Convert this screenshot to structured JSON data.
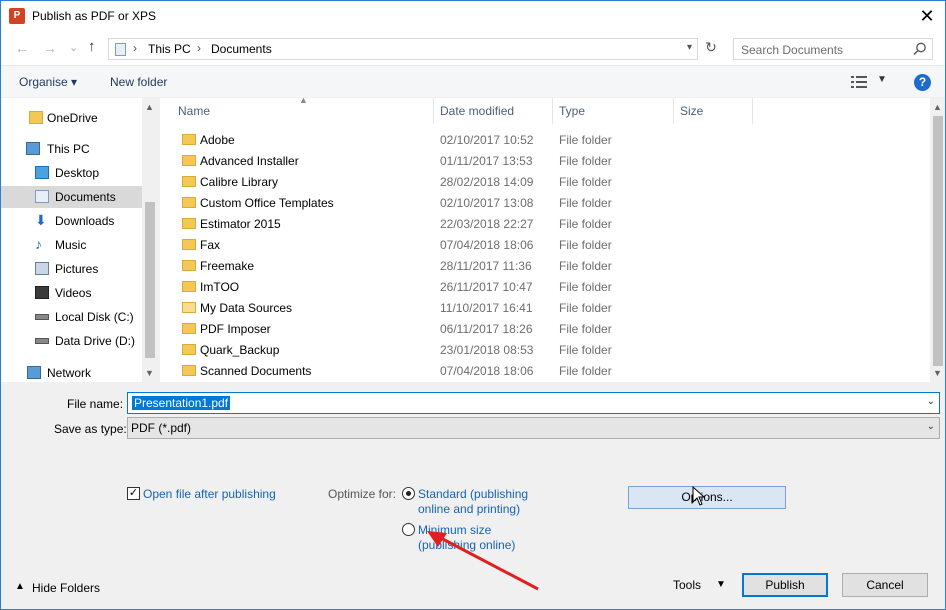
{
  "window": {
    "title": "Publish as PDF or XPS",
    "app_icon": "P",
    "close_glyph": "✕"
  },
  "nav": {
    "back_glyph": "←",
    "forward_glyph": "→",
    "recent_glyph": "⌄",
    "up_glyph": "↑",
    "breadcrumbs": [
      "This PC",
      "Documents"
    ],
    "search_placeholder": "Search Documents"
  },
  "toolbar": {
    "organise": "Organise ▾",
    "new_folder": "New folder",
    "help": "?"
  },
  "sidebar": {
    "items": [
      {
        "label": "OneDrive",
        "icon": "folder-icon"
      },
      {
        "label": "This PC",
        "icon": "computer-icon"
      },
      {
        "label": "Desktop",
        "icon": "desktop-icon"
      },
      {
        "label": "Documents",
        "icon": "documents-icon",
        "selected": true
      },
      {
        "label": "Downloads",
        "icon": "download-icon"
      },
      {
        "label": "Music",
        "icon": "music-icon"
      },
      {
        "label": "Pictures",
        "icon": "pictures-icon"
      },
      {
        "label": "Videos",
        "icon": "videos-icon"
      },
      {
        "label": "Local Disk (C:)",
        "icon": "disk-icon"
      },
      {
        "label": "Data Drive (D:)",
        "icon": "disk-icon"
      },
      {
        "label": "Network",
        "icon": "network-icon"
      }
    ]
  },
  "files": {
    "columns": [
      "Name",
      "Date modified",
      "Type",
      "Size"
    ],
    "rows": [
      {
        "name": "Adobe",
        "date": "02/10/2017 10:52",
        "type": "File folder"
      },
      {
        "name": "Advanced Installer",
        "date": "01/11/2017 13:53",
        "type": "File folder"
      },
      {
        "name": "Calibre Library",
        "date": "28/02/2018 14:09",
        "type": "File folder"
      },
      {
        "name": "Custom Office Templates",
        "date": "02/10/2017 13:08",
        "type": "File folder"
      },
      {
        "name": "Estimator 2015",
        "date": "22/03/2018 22:27",
        "type": "File folder"
      },
      {
        "name": "Fax",
        "date": "07/04/2018 18:06",
        "type": "File folder"
      },
      {
        "name": "Freemake",
        "date": "28/11/2017 11:36",
        "type": "File folder"
      },
      {
        "name": "ImTOO",
        "date": "26/11/2017 10:47",
        "type": "File folder"
      },
      {
        "name": "My Data Sources",
        "date": "11/10/2017 16:41",
        "type": "File folder"
      },
      {
        "name": "PDF Imposer",
        "date": "06/11/2017 18:26",
        "type": "File folder"
      },
      {
        "name": "Quark_Backup",
        "date": "23/01/2018 08:53",
        "type": "File folder"
      },
      {
        "name": "Scanned Documents",
        "date": "07/04/2018 18:06",
        "type": "File folder"
      }
    ]
  },
  "form": {
    "filename_label": "File name:",
    "filename_value": "Presentation1.pdf",
    "savetype_label": "Save as type:",
    "savetype_value": "PDF (*.pdf)",
    "open_after_label": "Open file after publishing",
    "open_after_checked": true,
    "optimize_label": "Optimize for:",
    "opt_standard_line1": "Standard (publishing",
    "opt_standard_line2": "online and printing)",
    "opt_min_line1": "Minimum size",
    "opt_min_line2": "(publishing online)",
    "options_button": "Options..."
  },
  "footer": {
    "hide_folders": "Hide Folders",
    "tools": "Tools",
    "publish": "Publish",
    "cancel": "Cancel"
  },
  "colors": {
    "accent": "#0078d7",
    "link": "#1463b7",
    "annotation_arrow": "#e02020"
  }
}
